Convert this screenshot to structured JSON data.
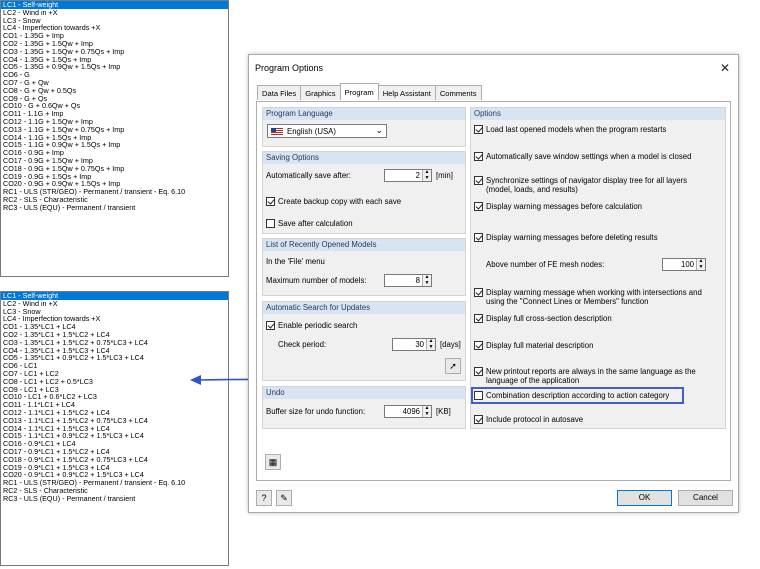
{
  "list_top": {
    "items": [
      "LC1 - Self-weight",
      "LC2 - Wind in +X",
      "LC3 - Snow",
      "LC4 - Imperfection towards +X",
      "CO1 - 1.35G + Imp",
      "CO2 - 1.35G + 1.5Qw + Imp",
      "CO3 - 1.35G + 1.5Qw + 0.75Qs + Imp",
      "CO4 - 1.35G + 1.5Qs + Imp",
      "CO5 - 1.35G + 0.9Qw + 1.5Qs + Imp",
      "CO6 - G",
      "CO7 - G + Qw",
      "CO8 - G + Qw + 0.5Qs",
      "CO9 - G + Qs",
      "CO10 - G + 0.6Qw + Qs",
      "CO11 - 1.1G + Imp",
      "CO12 - 1.1G + 1.5Qw + Imp",
      "CO13 - 1.1G + 1.5Qw + 0.75Qs + Imp",
      "CO14 - 1.1G + 1.5Qs + Imp",
      "CO15 - 1.1G + 0.9Qw + 1.5Qs + Imp",
      "CO16 - 0.9G + Imp",
      "CO17 - 0.9G + 1.5Qw + Imp",
      "CO18 - 0.9G + 1.5Qw + 0.75Qs + Imp",
      "CO19 - 0.9G + 1.5Qs + Imp",
      "CO20 - 0.9G + 0.9Qw + 1.5Qs + Imp",
      "RC1 - ULS (STR/GEO) - Permanent / transient - Eq. 6.10",
      "RC2 - SLS - Characteristic",
      "RC3 - ULS (EQU) - Permanent / transient"
    ]
  },
  "list_bottom": {
    "items": [
      "LC1 - Self-weight",
      "LC2 - Wind in +X",
      "LC3 - Snow",
      "LC4 - Imperfection towards +X",
      "CO1 - 1.35*LC1 + LC4",
      "CO2 - 1.35*LC1 + 1.5*LC2 + LC4",
      "CO3 - 1.35*LC1 + 1.5*LC2 + 0.75*LC3 + LC4",
      "CO4 - 1.35*LC1 + 1.5*LC3 + LC4",
      "CO5 - 1.35*LC1 + 0.9*LC2 + 1.5*LC3 + LC4",
      "CO6 - LC1",
      "CO7 - LC1 + LC2",
      "CO8 - LC1 + LC2 + 0.5*LC3",
      "CO9 - LC1 + LC3",
      "CO10 - LC1 + 0.6*LC2 + LC3",
      "CO11 - 1.1*LC1 + LC4",
      "CO12 - 1.1*LC1 + 1.5*LC2 + LC4",
      "CO13 - 1.1*LC1 + 1.5*LC2 + 0.75*LC3 + LC4",
      "CO14 - 1.1*LC1 + 1.5*LC3 + LC4",
      "CO15 - 1.1*LC1 + 0.9*LC2 + 1.5*LC3 + LC4",
      "CO16 - 0.9*LC1 + LC4",
      "CO17 - 0.9*LC1 + 1.5*LC2 + LC4",
      "CO18 - 0.9*LC1 + 1.5*LC2 + 0.75*LC3 + LC4",
      "CO19 - 0.9*LC1 + 1.5*LC3 + LC4",
      "CO20 - 0.9*LC1 + 0.9*LC2 + 1.5*LC3 + LC4",
      "RC1 - ULS (STR/GEO) - Permanent / transient - Eq. 6.10",
      "RC2 - SLS - Characteristic",
      "RC3 - ULS (EQU) - Permanent / transient"
    ]
  },
  "dialog": {
    "title": "Program Options",
    "close_glyph": "✕",
    "tabs": [
      "Data Files",
      "Graphics",
      "Program",
      "Help Assistant",
      "Comments"
    ],
    "active_tab": "Program",
    "language": {
      "header": "Program Language",
      "selected": "English (USA)",
      "arrow": "⌄"
    },
    "saving": {
      "header": "Saving Options",
      "auto_save_label": "Automatically save after:",
      "auto_save_value": "2",
      "auto_save_unit": "[min]",
      "backup_label": "Create backup copy with each save",
      "backup_checked": true,
      "after_calc_label": "Save after calculation",
      "after_calc_checked": false
    },
    "recent": {
      "header": "List of Recently Opened Models",
      "in_file_menu": "In the 'File' menu",
      "max_label": "Maximum number of models:",
      "max_value": "8"
    },
    "updates": {
      "header": "Automatic Search for Updates",
      "enable_label": "Enable periodic search",
      "enable_checked": true,
      "period_label": "Check period:",
      "period_value": "30",
      "period_unit": "[days]"
    },
    "undo": {
      "header": "Undo",
      "buffer_label": "Buffer size for undo function:",
      "buffer_value": "4096",
      "buffer_unit": "[KB]"
    },
    "options": {
      "header": "Options",
      "items": [
        {
          "label": "Load last opened models when the program restarts",
          "checked": true
        },
        {
          "label": "Automatically save window settings when a model is closed",
          "checked": true
        },
        {
          "label": "Synchronize settings of navigator display tree for all layers (model, loads, and results)",
          "checked": true
        },
        {
          "label": "Display warning messages before calculation",
          "checked": true
        },
        {
          "label": "Display warning messages before deleting results",
          "checked": true
        },
        {
          "label": "Display warning message when working with intersections and using the \"Connect Lines or Members\" function",
          "checked": true
        },
        {
          "label": "Display full cross-section description",
          "checked": true
        },
        {
          "label": "Display full material description",
          "checked": true
        },
        {
          "label": "New printout reports are always in the same language as the language of the application",
          "checked": true
        },
        {
          "label": "Combination description according to action category",
          "checked": false
        },
        {
          "label": "Include protocol in autosave",
          "checked": true
        }
      ],
      "fe_nodes_label": "Above number of FE mesh nodes:",
      "fe_nodes_value": "100"
    },
    "ok_label": "OK",
    "cancel_label": "Cancel"
  },
  "colors": {
    "selection": "#0078d7",
    "group_header": "#d9e4f2",
    "highlight_box": "#3f5fc9",
    "arrow": "#2f55c9"
  }
}
